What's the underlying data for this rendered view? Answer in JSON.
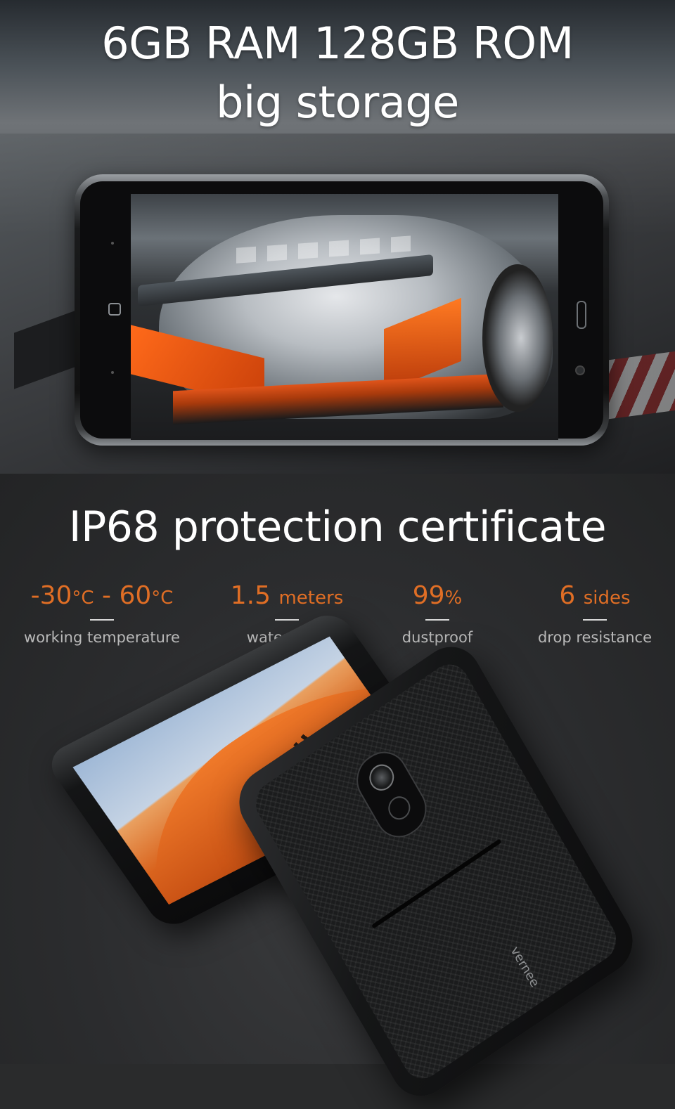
{
  "hero": {
    "line1": "6GB RAM 128GB ROM",
    "line2": "big storage"
  },
  "ip68": {
    "title": "IP68 protection certificate",
    "accent_color": "#e06e25",
    "stats": [
      {
        "value": "-30",
        "unit": "°C",
        "sep": " - ",
        "value2": "60",
        "unit2": "°C",
        "label": "working temperature"
      },
      {
        "value": "1.5",
        "unit": "meters",
        "label": "waterproof"
      },
      {
        "value": "99",
        "unit": "%",
        "label": "dustproof"
      },
      {
        "value": "6",
        "unit": "sides",
        "label": "drop resistance"
      }
    ]
  },
  "brand_mark": "vernee"
}
